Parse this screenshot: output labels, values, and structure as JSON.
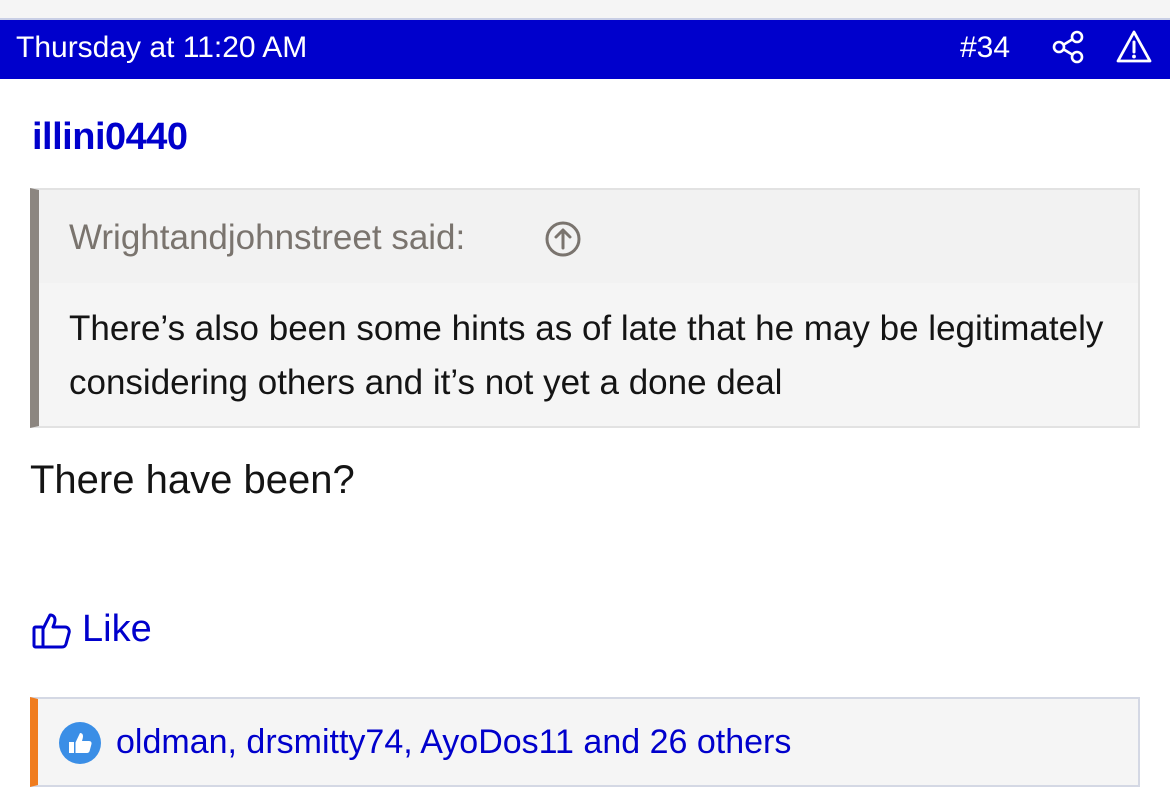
{
  "post": {
    "date": "Thursday at 11:20 AM",
    "number": "#34",
    "author": "illini0440",
    "quote": {
      "attribution": "Wrightandjohnstreet said:",
      "text": "There’s also been some hints as of late that he may be legitimately considering others and it’s not yet a done deal"
    },
    "reply": "There have been?",
    "like_label": "Like",
    "reactions_text": "oldman, drsmitty74, AyoDos11 and 26 others"
  },
  "colors": {
    "header_bg": "#0000cc",
    "link": "#0000cc",
    "quote_border": "#8c8680",
    "reaction_accent": "#f07c1e",
    "like_badge": "#3a8ee6"
  },
  "icons": {
    "share": "share-icon",
    "report": "warning-triangle-icon",
    "quote_jump": "arrow-up-circle-icon",
    "like": "thumbs-up-outline-icon",
    "reaction": "thumbs-up-badge-icon"
  }
}
